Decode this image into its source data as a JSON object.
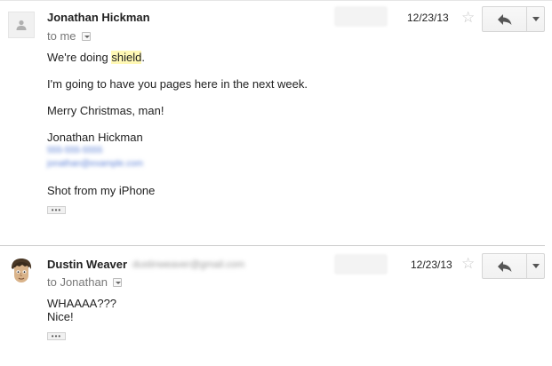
{
  "messages": [
    {
      "sender": "Jonathan Hickman",
      "recipient": "to me",
      "date": "12/23/13",
      "body": {
        "line1_prefix": "We're doing ",
        "line1_highlight": "shield",
        "line1_suffix": ".",
        "line2": "I'm going to have you pages here in the next week.",
        "line3": "Merry Christmas, man!",
        "signature_name": "Jonathan Hickman",
        "signature_phone": "555-555-5555",
        "signature_email": "jonathan@example.com",
        "closing": "Shot from my iPhone"
      },
      "ellipsis": "•••"
    },
    {
      "sender": "Dustin Weaver",
      "sender_email": "dustinweaver@gmail.com",
      "recipient": "to Jonathan",
      "date": "12/23/13",
      "body": {
        "line1": "WHAAAA???",
        "line2": "Nice!"
      },
      "ellipsis": "•••"
    }
  ],
  "icons": {
    "star": "☆",
    "reply": "reply-arrow",
    "more": "caret-down",
    "person": "default-avatar"
  },
  "colors": {
    "highlight": "#fff8b5",
    "link": "#5a7fd6",
    "divider": "#cccccc"
  }
}
